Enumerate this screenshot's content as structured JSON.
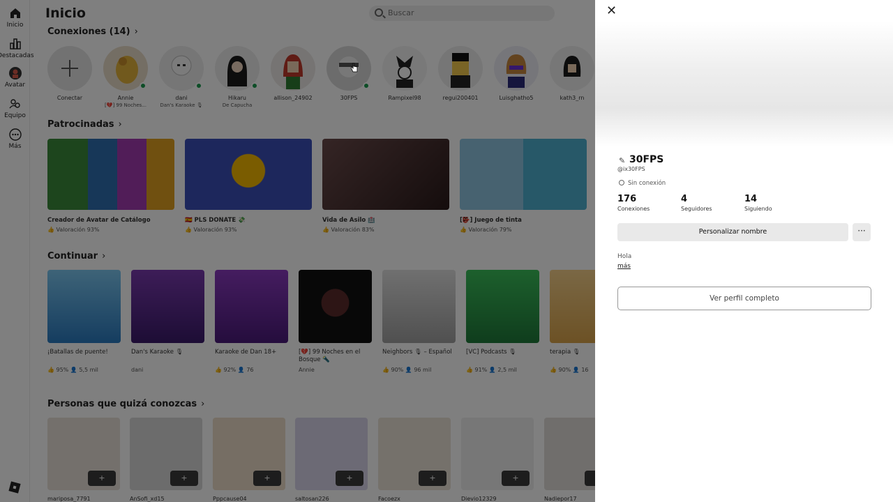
{
  "nav": {
    "items": [
      {
        "label": "Inicio",
        "icon": "home-icon"
      },
      {
        "label": "Destacadas",
        "icon": "charts-icon"
      },
      {
        "label": "Avatar",
        "icon": "avatar-icon"
      },
      {
        "label": "Equipo",
        "icon": "team-icon"
      },
      {
        "label": "Más",
        "icon": "more-icon"
      }
    ]
  },
  "header": {
    "title": "Inicio",
    "search_placeholder": "Buscar"
  },
  "connections": {
    "title": "Conexiones (14)",
    "add_label": "Conectar",
    "friends": [
      {
        "name": "Annie",
        "status": "[💔] 99 Noches...",
        "online": true
      },
      {
        "name": "dani",
        "status": "Dan's Karaoke 🎙",
        "online": true
      },
      {
        "name": "Hikaru",
        "status": "De Capucha",
        "online": true
      },
      {
        "name": "allison_24902",
        "status": "",
        "online": false
      },
      {
        "name": "30FPS",
        "status": "",
        "online": true
      },
      {
        "name": "Rampixel98",
        "status": "",
        "online": false
      },
      {
        "name": "regui200401",
        "status": "",
        "online": false
      },
      {
        "name": "Luisghatho5",
        "status": "",
        "online": false
      },
      {
        "name": "kath3_rn",
        "status": "",
        "online": false
      }
    ]
  },
  "sponsored": {
    "title": "Patrocinadas",
    "items": [
      {
        "title": "Creador de Avatar de Catálogo",
        "rating": "Valoración 93%",
        "color": "#3a8a3a"
      },
      {
        "title": "🇪🇸 PLS DONATE 💸",
        "rating": "Valoración 93%",
        "color": "#3b4fb8"
      },
      {
        "title": "Vida de Asilo 🏥",
        "rating": "Valoración 83%",
        "color": "#4a3a3a"
      },
      {
        "title": "[👺] Juego de tinta",
        "rating": "Valoración 79%",
        "color": "#5fa7c9"
      }
    ]
  },
  "continue": {
    "title": "Continuar",
    "items": [
      {
        "title": "¡Batallas de puente!",
        "meta": "👍 95%  👤 5,5 mil",
        "color": "#4aa3e0"
      },
      {
        "title": "Dan's Karaoke 🎙",
        "meta": "dani",
        "color": "#5a2a8a"
      },
      {
        "title": "Karaoke de Dan 18+",
        "meta": "👍 92%  👤 76",
        "color": "#6a2a9a"
      },
      {
        "title": "[💔] 99 Noches en el Bosque 🔦",
        "meta": "Annie",
        "color": "#1a1a1a"
      },
      {
        "title": "Neighbors 🎙 – Español",
        "meta": "👍 90%  👤 96 mil",
        "color": "#b8b8b8"
      },
      {
        "title": "[VC] Podcasts 🎙",
        "meta": "👍 91%  👤 2,5 mil",
        "color": "#2fa84a"
      },
      {
        "title": "terapia 🎙",
        "meta": "👍 90%  👤 16",
        "color": "#d9a34a"
      }
    ]
  },
  "people": {
    "title": "Personas que quizá conozcas",
    "items": [
      {
        "name": "mariposa_7791"
      },
      {
        "name": "AnSofi_xd15"
      },
      {
        "name": "Pppcause04"
      },
      {
        "name": "saltosan226"
      },
      {
        "name": "Facoezx"
      },
      {
        "name": "Dievio12329"
      },
      {
        "name": "Nadiepor17"
      }
    ],
    "add_symbol": "+"
  },
  "profile": {
    "display_name": "30FPS",
    "username": "@ix30FPS",
    "status": "Sin conexión",
    "stats": [
      {
        "num": "176",
        "label": "Conexiones"
      },
      {
        "num": "4",
        "label": "Seguidores"
      },
      {
        "num": "14",
        "label": "Siguiendo"
      }
    ],
    "customize_label": "Personalizar nombre",
    "more_label": "···",
    "bio": "Hola",
    "more_link": "más",
    "full_profile_label": "Ver perfil completo",
    "close_label": "✕",
    "pencil": "✎"
  }
}
